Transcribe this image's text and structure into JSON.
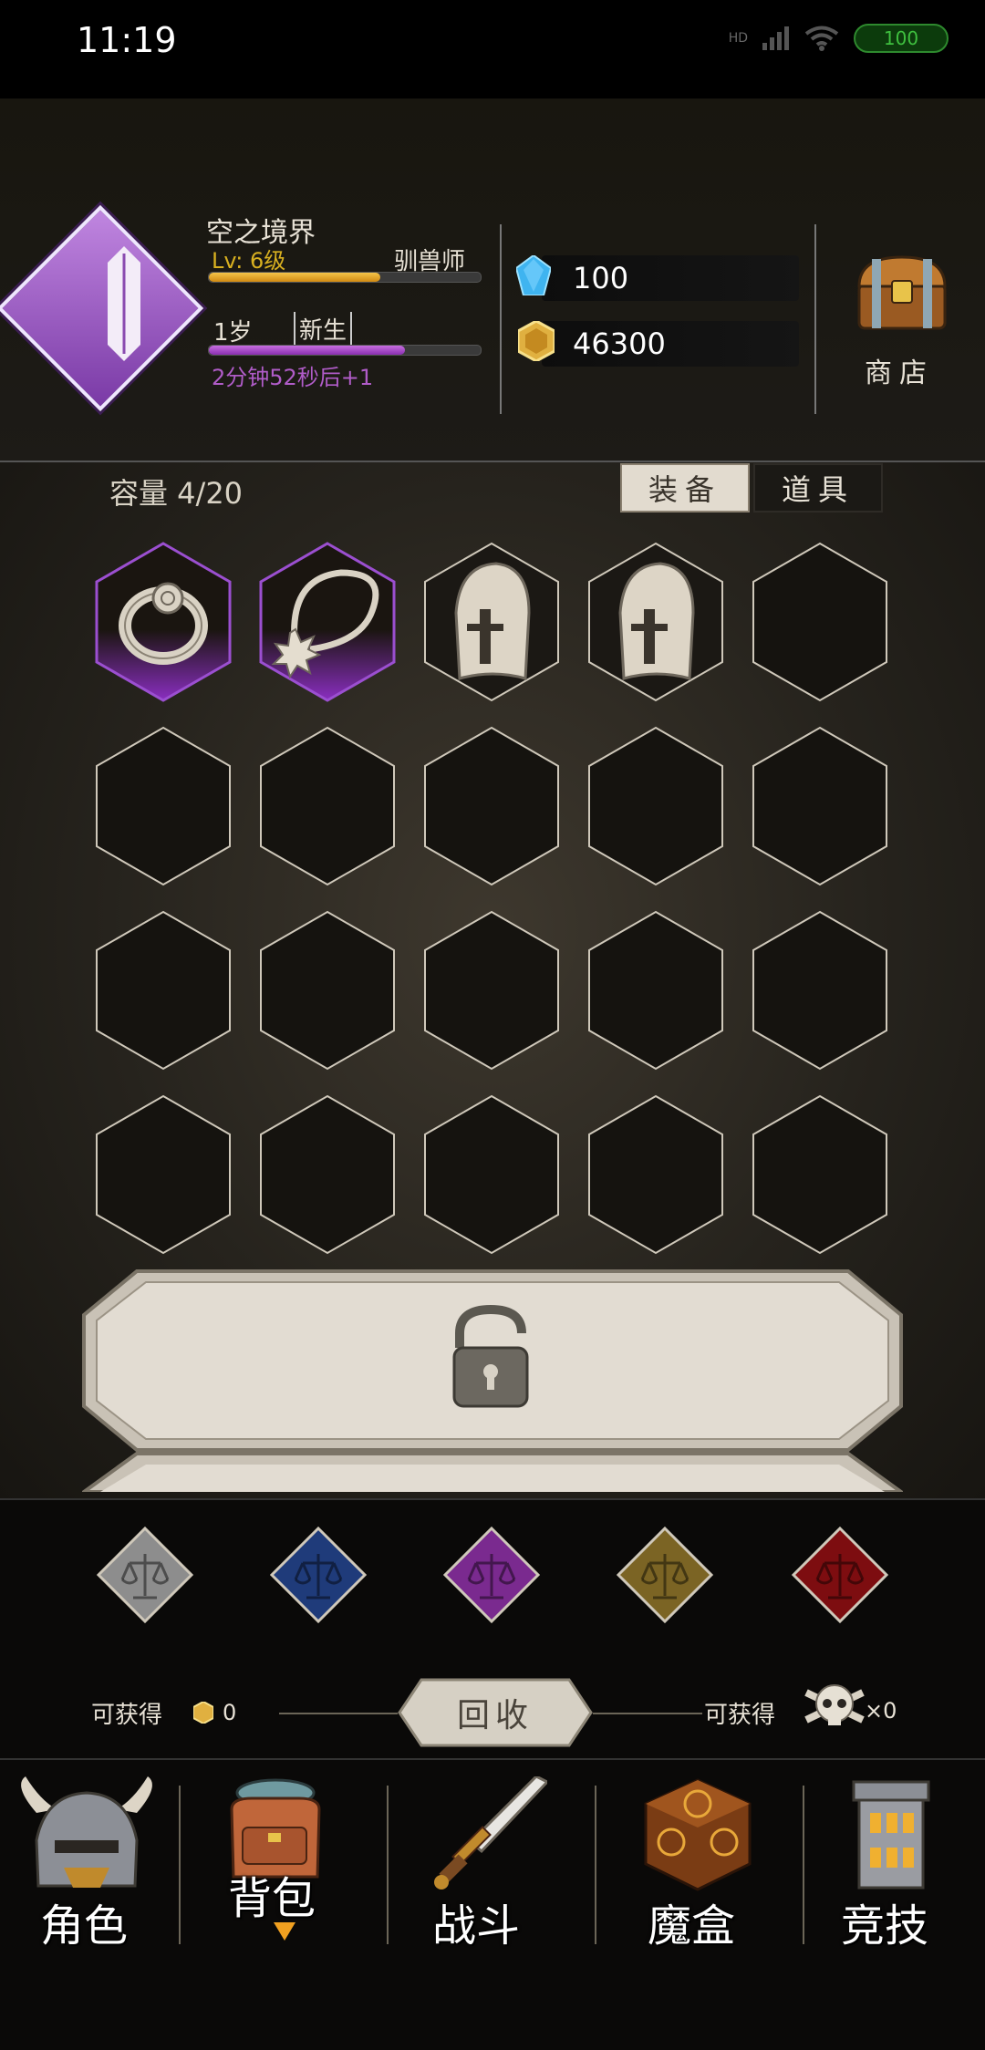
{
  "status_bar": {
    "time": "11:19",
    "network": "HD",
    "battery": "100"
  },
  "profile": {
    "name": "空之境界",
    "level": "Lv: 6级",
    "job": "驯兽师",
    "level_progress": 0.63,
    "age": "1岁",
    "stage": "新生",
    "age_progress": 0.72,
    "timer": "2分钟52秒后+1",
    "avatar_color": "#9b59c9"
  },
  "currency": {
    "gems": "100",
    "coins": "46300"
  },
  "shop": {
    "label": "商店",
    "icon": "treasure-chest-icon"
  },
  "inventory": {
    "capacity_label": "容量 4/20",
    "tabs": [
      {
        "label": "装备",
        "active": true
      },
      {
        "label": "道具",
        "active": false
      }
    ],
    "slots": [
      {
        "item": "ring-icon",
        "rarity": "purple"
      },
      {
        "item": "amulet-icon",
        "rarity": "purple"
      },
      {
        "item": "helmet-icon",
        "rarity": "common"
      },
      {
        "item": "helmet-icon",
        "rarity": "common"
      },
      {
        "item": "",
        "rarity": "empty"
      }
    ],
    "locked_icon": "padlock-icon"
  },
  "recycle": {
    "rarity_filters": [
      {
        "name": "grey-scale-icon",
        "color": "#8d8d8d"
      },
      {
        "name": "blue-scale-icon",
        "color": "#1f3b7a"
      },
      {
        "name": "purple-scale-icon",
        "color": "#7a2a8f"
      },
      {
        "name": "gold-scale-icon",
        "color": "#7b6424"
      },
      {
        "name": "red-scale-icon",
        "color": "#7d0d10"
      }
    ],
    "left_label": "可获得",
    "left_value": "0",
    "button_label": "回收",
    "right_label": "可获得",
    "right_value": "×0"
  },
  "nav": [
    {
      "label": "角色",
      "icon": "helmet-icon"
    },
    {
      "label": "背包",
      "icon": "backpack-icon",
      "active": true
    },
    {
      "label": "战斗",
      "icon": "sword-icon"
    },
    {
      "label": "魔盒",
      "icon": "magic-box-icon"
    },
    {
      "label": "竞技",
      "icon": "tower-icon"
    }
  ]
}
